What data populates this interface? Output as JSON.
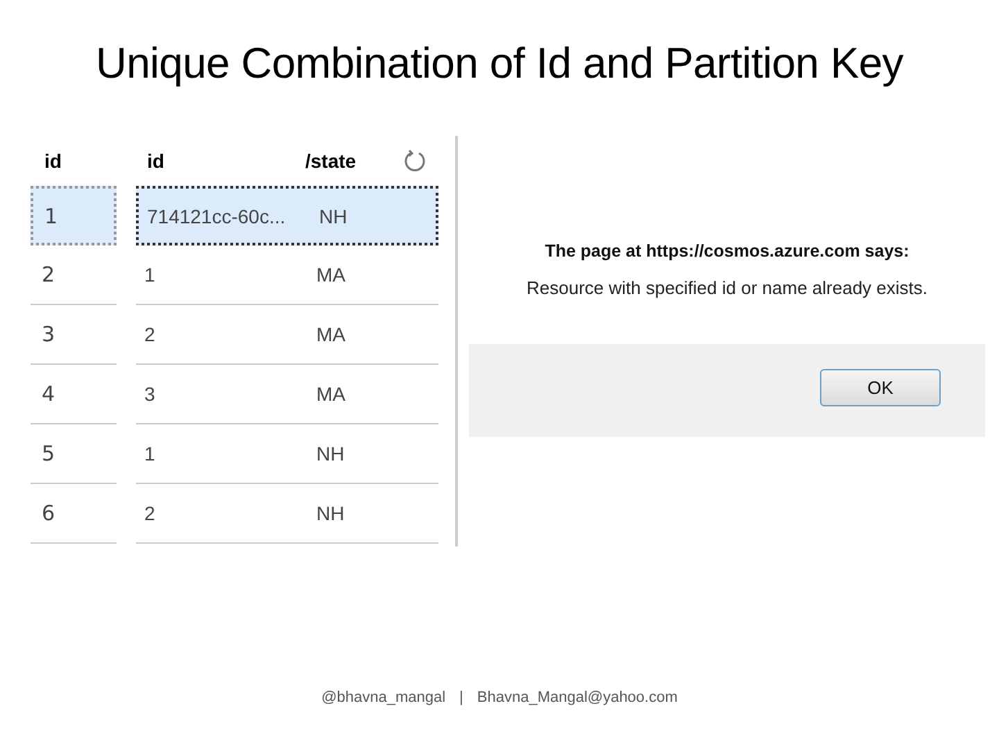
{
  "title": "Unique Combination of Id and Partition Key",
  "table": {
    "columns": [
      "id",
      "id",
      "/state"
    ],
    "rows": [
      {
        "index": "1",
        "id": "714121cc-60c...",
        "state": "NH",
        "selected": true
      },
      {
        "index": "2",
        "id": "1",
        "state": "MA",
        "selected": false
      },
      {
        "index": "3",
        "id": "2",
        "state": "MA",
        "selected": false
      },
      {
        "index": "4",
        "id": "3",
        "state": "MA",
        "selected": false
      },
      {
        "index": "5",
        "id": "1",
        "state": "NH",
        "selected": false
      },
      {
        "index": "6",
        "id": "2",
        "state": "NH",
        "selected": false
      }
    ]
  },
  "dialog": {
    "heading": "The page at https://cosmos.azure.com says:",
    "message": "Resource with specified id or name already exists.",
    "buttons": [
      "OK"
    ]
  },
  "footer": {
    "handle": "@bhavna_mangal",
    "separator": "|",
    "email": "Bhavna_Mangal@yahoo.com"
  }
}
